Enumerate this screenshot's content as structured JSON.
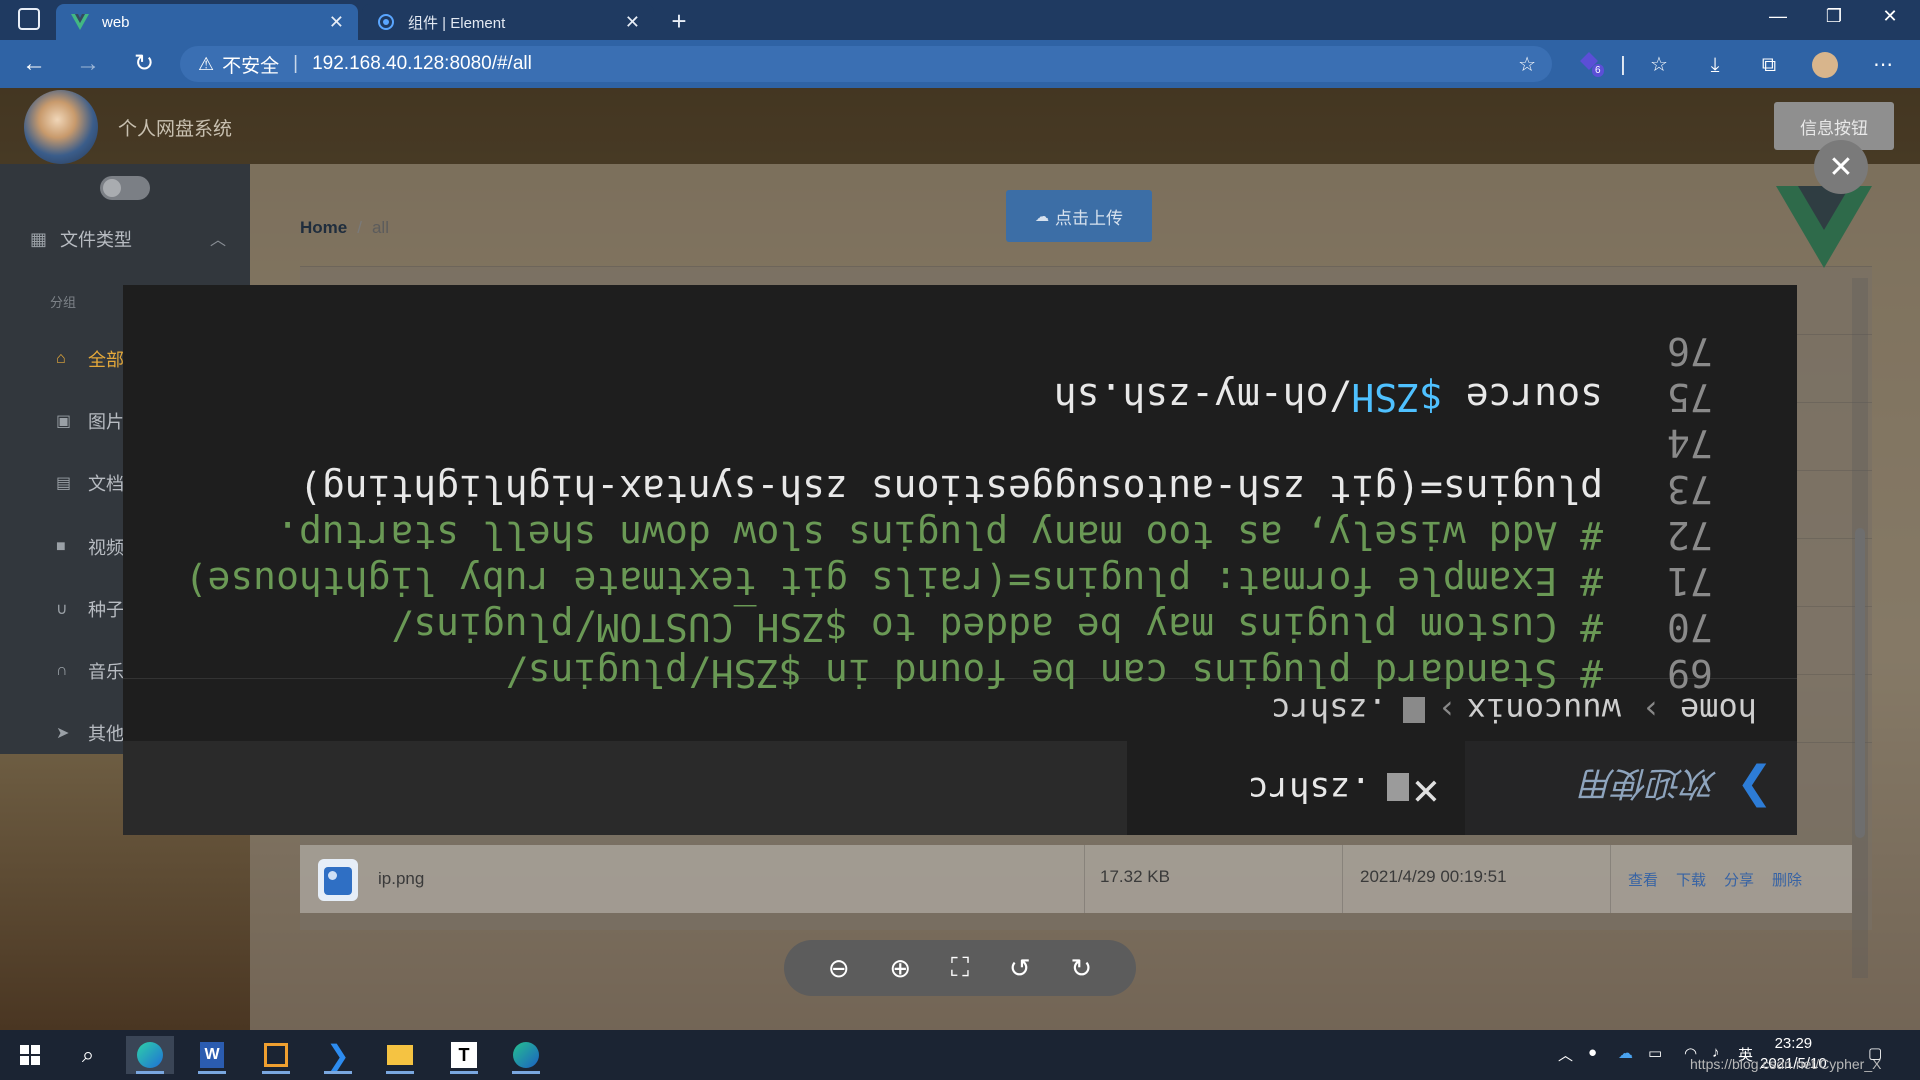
{
  "browser": {
    "tabs": [
      {
        "title": "web",
        "icon": "vue-logo-icon"
      },
      {
        "title": "组件 | Element",
        "icon": "element-logo-icon"
      }
    ],
    "url_warning": "不安全",
    "url": "192.168.40.128:8080/#/all",
    "extension_badge": "6"
  },
  "site": {
    "name": "个人网盘系统",
    "info_button": "信息按钮",
    "upload_button": "点击上传"
  },
  "sidebar": {
    "group": "文件类型",
    "subgroup": "分组",
    "items": [
      {
        "label": "全部",
        "icon": "home-icon",
        "active": true
      },
      {
        "label": "图片",
        "icon": "image-icon"
      },
      {
        "label": "文档",
        "icon": "document-icon"
      },
      {
        "label": "视频",
        "icon": "video-icon"
      },
      {
        "label": "种子",
        "icon": "magnet-icon"
      },
      {
        "label": "音乐",
        "icon": "headphones-icon"
      },
      {
        "label": "其他",
        "icon": "send-icon"
      }
    ]
  },
  "breadcrumb": {
    "home": "Home",
    "current": "all"
  },
  "file": {
    "name": "ip.png",
    "size": "17.32 KB",
    "time": "2021/4/29 00:19:51",
    "actions": [
      "查看",
      "下载",
      "分享",
      "删除"
    ]
  },
  "preview": {
    "welcome_tab": "欢迎使用",
    "file_tab": ".zshrc",
    "crumb": [
      "home",
      "wuuconix",
      ".zshrc"
    ],
    "lines": [
      {
        "n": "69",
        "text": "# Standard plugins can be found in $ZSH/plugins/"
      },
      {
        "n": "70",
        "text": "# Custom plugins may be added to $ZSH_CUSTOM/plugins/"
      },
      {
        "n": "71",
        "text": "# Example format: plugins=(rails git textmate ruby lighthouse)"
      },
      {
        "n": "72",
        "text": "# Add wisely, as too many plugins slow down shell startup."
      },
      {
        "n": "73",
        "text": "plugins=(git zsh-autosuggestions zsh-syntax-highlighting)"
      },
      {
        "n": "74",
        "text": ""
      },
      {
        "n": "75",
        "text_pre": "source ",
        "text_var": "$ZSH",
        "text_post": "/oh-my-zsh.sh"
      },
      {
        "n": "76",
        "text": ""
      }
    ]
  },
  "taskbar": {
    "time": "23:29",
    "date": "2021/5/10",
    "ime": "英",
    "watermark": "https://blog.csdn.net/Cypher_X"
  }
}
